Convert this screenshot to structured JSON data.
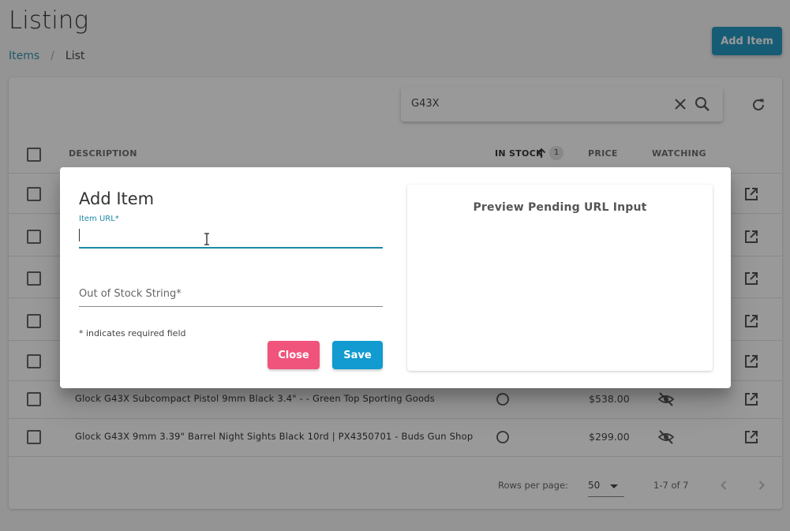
{
  "page": {
    "title": "Listing",
    "breadcrumb": {
      "link": "Items",
      "separator": "/",
      "current": "List"
    },
    "add_button": "Add Item"
  },
  "search": {
    "value": "G43X"
  },
  "table": {
    "columns": [
      "DESCRIPTION",
      "IN STOCK",
      "PRICE",
      "WATCHING"
    ],
    "sort_badge": "1",
    "rows": [
      {
        "description": "Glock G43X Subcompact Pistol 9mm Black 3.4\" - - Green Top Sporting Goods",
        "price": "$538.00"
      },
      {
        "description": "Glock G43X 9mm 3.39\" Barrel Night Sights Black 10rd | PX4350701 - Buds Gun Shop",
        "price": "$299.00"
      }
    ]
  },
  "footer": {
    "rows_per_page_label": "Rows per page:",
    "rows_per_page_value": "50",
    "range": "1-7 of 7"
  },
  "dialog": {
    "title": "Add Item",
    "url_label": "Item URL*",
    "url_value": "",
    "oos_label": "Out of Stock String*",
    "required_note": "* indicates required field",
    "close_label": "Close",
    "save_label": "Save",
    "preview_title": "Preview Pending URL Input"
  },
  "colors": {
    "accent": "#1e88a8",
    "primary_button": "#119bd0",
    "close_button": "#f0537c"
  }
}
